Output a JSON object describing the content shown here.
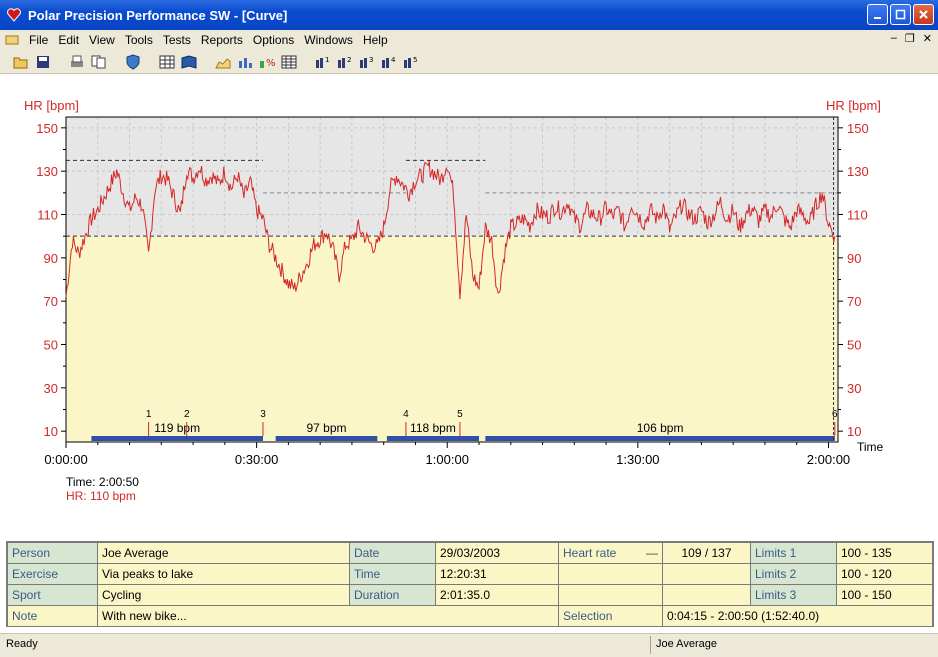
{
  "window": {
    "title": "Polar Precision Performance SW - [Curve]"
  },
  "menu": [
    "File",
    "Edit",
    "View",
    "Tools",
    "Tests",
    "Reports",
    "Options",
    "Windows",
    "Help"
  ],
  "toolbar_icons": [
    "open-icon",
    "save-icon",
    "print-icon",
    "copy-icon",
    "shield-icon",
    "table-icon",
    "book-icon",
    "area-chart-icon",
    "bar-chart-icon",
    "percent-chart-icon",
    "grid-icon",
    "compare-1-icon",
    "compare-2-icon",
    "compare-3-icon",
    "compare-4-icon",
    "compare-5-icon"
  ],
  "readout": {
    "time": "Time: 2:00:50",
    "hr": "HR: 110 bpm"
  },
  "chart_data": {
    "type": "line",
    "ylabel_left": "HR [bpm]",
    "ylabel_right": "HR [bpm]",
    "xlabel": "Time",
    "y_ticks": [
      "150",
      "130",
      "110",
      "90",
      "70",
      "50",
      "30",
      "10"
    ],
    "x_ticks": [
      "0:00:00",
      "0:30:00",
      "1:00:00",
      "1:30:00",
      "2:00:00"
    ],
    "ylim": [
      5,
      155
    ],
    "xlim_min": [
      0,
      121.5
    ],
    "limits": {
      "limit1": [
        100,
        135
      ],
      "limit2": [
        100,
        120
      ],
      "limit3": [
        100,
        150
      ]
    },
    "laps": [
      {
        "label": "1",
        "t": 13
      },
      {
        "label": "2",
        "t": 19
      },
      {
        "label": "3",
        "t": 31
      },
      {
        "label": "4",
        "t": 53.5
      },
      {
        "label": "5",
        "t": 62
      },
      {
        "label": "6",
        "t": 121
      }
    ],
    "zones": [
      {
        "label": "119 bpm",
        "start": 4,
        "end": 31
      },
      {
        "label": "97 bpm",
        "start": 33,
        "end": 49
      },
      {
        "label": "118 bpm",
        "start": 50.5,
        "end": 65
      },
      {
        "label": "106 bpm",
        "start": 66,
        "end": 121
      }
    ],
    "series": [
      {
        "name": "HR",
        "x": [
          0,
          1,
          2,
          3,
          4,
          5,
          6,
          7,
          8,
          9,
          10,
          11,
          12,
          13,
          14,
          15,
          16,
          17,
          18,
          19,
          20,
          21,
          22,
          23,
          24,
          25,
          26,
          27,
          28,
          29,
          30,
          31,
          32,
          33,
          34,
          35,
          36,
          37,
          38,
          39,
          40,
          41,
          42,
          43,
          44,
          45,
          46,
          47,
          48,
          49,
          50,
          51,
          52,
          53,
          54,
          55,
          56,
          57,
          58,
          59,
          60,
          61,
          62,
          63,
          64,
          65,
          66,
          67,
          68,
          69,
          70,
          71,
          72,
          73,
          74,
          75,
          76,
          77,
          78,
          79,
          80,
          81,
          82,
          83,
          84,
          85,
          86,
          87,
          88,
          89,
          90,
          91,
          92,
          93,
          94,
          95,
          96,
          97,
          98,
          99,
          100,
          101,
          102,
          103,
          104,
          105,
          106,
          107,
          108,
          109,
          110,
          111,
          112,
          113,
          114,
          115,
          116,
          117,
          118,
          119,
          120,
          121
        ],
        "y": [
          72,
          98,
          92,
          100,
          108,
          112,
          118,
          124,
          130,
          120,
          112,
          118,
          114,
          91,
          122,
          128,
          126,
          118,
          110,
          131,
          127,
          132,
          126,
          128,
          124,
          130,
          122,
          128,
          118,
          125,
          112,
          108,
          96,
          90,
          84,
          78,
          76,
          82,
          88,
          96,
          99,
          102,
          94,
          82,
          96,
          98,
          104,
          100,
          96,
          95,
          104,
          122,
          128,
          124,
          120,
          126,
          128,
          132,
          129,
          126,
          134,
          120,
          74,
          110,
          82,
          76,
          104,
          98,
          72,
          92,
          104,
          106,
          108,
          105,
          112,
          110,
          109,
          114,
          111,
          116,
          108,
          105,
          112,
          110,
          108,
          113,
          109,
          112,
          104,
          115,
          110,
          106,
          112,
          108,
          114,
          103,
          109,
          115,
          110,
          108,
          112,
          106,
          110,
          116,
          108,
          112,
          104,
          110,
          113,
          107,
          112,
          109,
          115,
          108,
          104,
          112,
          110,
          106,
          114,
          120,
          106,
          100
        ]
      }
    ]
  },
  "info": {
    "person_label": "Person",
    "person": "Joe Average",
    "exercise_label": "Exercise",
    "exercise": "Via peaks to lake",
    "sport_label": "Sport",
    "sport": "Cycling",
    "note_label": "Note",
    "note": "With new bike...",
    "date_label": "Date",
    "date": "29/03/2003",
    "time_label": "Time",
    "time": "12:20:31",
    "duration_label": "Duration",
    "duration": "2:01:35.0",
    "heartrate_label": "Heart rate",
    "heartrate": "109 / 137",
    "limits1_label": "Limits 1",
    "limits1": "100 - 135",
    "limits2_label": "Limits 2",
    "limits2": "100 - 120",
    "limits3_label": "Limits 3",
    "limits3": "100 - 150",
    "selection_label": "Selection",
    "selection": "0:04:15 - 2:00:50 (1:52:40.0)"
  },
  "status": {
    "left": "Ready",
    "right": "Joe Average"
  },
  "colors": {
    "hr": "#d42828",
    "zone_bar": "#3050a8",
    "plot_bg": "#fbf6c8",
    "upper_bg": "#e6e6e6"
  }
}
